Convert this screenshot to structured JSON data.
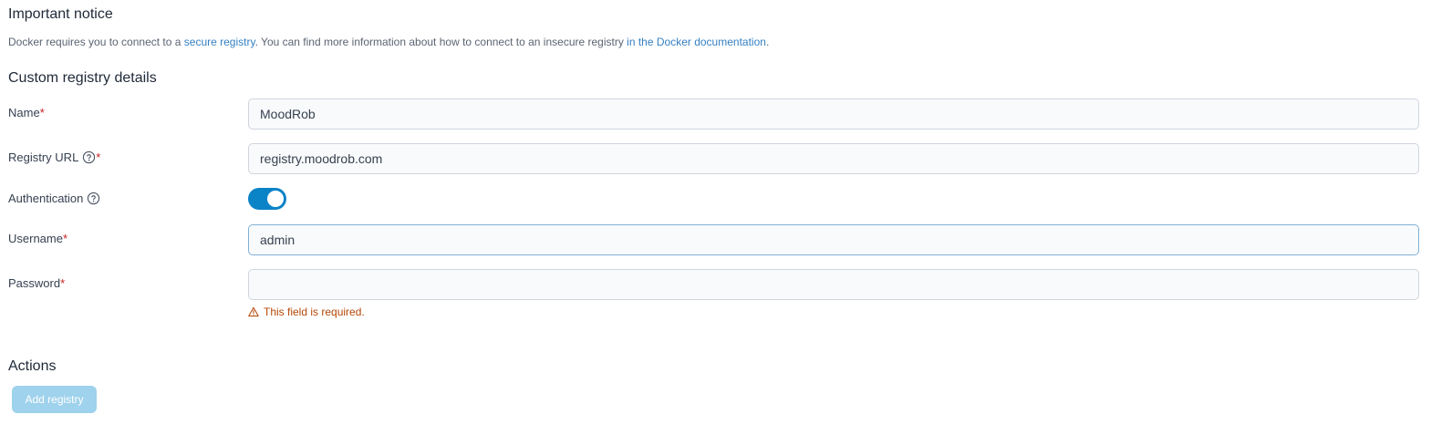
{
  "notice": {
    "title": "Important notice",
    "text_before": "Docker requires you to connect to a ",
    "link1": "secure registry",
    "text_middle": ". You can find more information about how to connect to an insecure registry ",
    "link2": "in the Docker documentation",
    "text_after": "."
  },
  "details": {
    "title": "Custom registry details",
    "fields": {
      "name": {
        "label": "Name",
        "required_mark": "*",
        "value": "MoodRob"
      },
      "registry_url": {
        "label": "Registry URL",
        "required_mark": "*",
        "value": "registry.moodrob.com"
      },
      "authentication": {
        "label": "Authentication",
        "enabled": true
      },
      "username": {
        "label": "Username",
        "required_mark": "*",
        "value": "admin"
      },
      "password": {
        "label": "Password",
        "required_mark": "*",
        "value": "",
        "error": "This field is required."
      }
    }
  },
  "actions": {
    "title": "Actions",
    "add_registry": "Add registry"
  },
  "colors": {
    "accent": "#0b83c7",
    "link": "#3680c2",
    "required": "#c81e1e",
    "error": "#b54708",
    "button_disabled": "#9fd2ec"
  },
  "icons": {
    "help": "question-circle-icon",
    "warning": "warning-triangle-icon"
  }
}
